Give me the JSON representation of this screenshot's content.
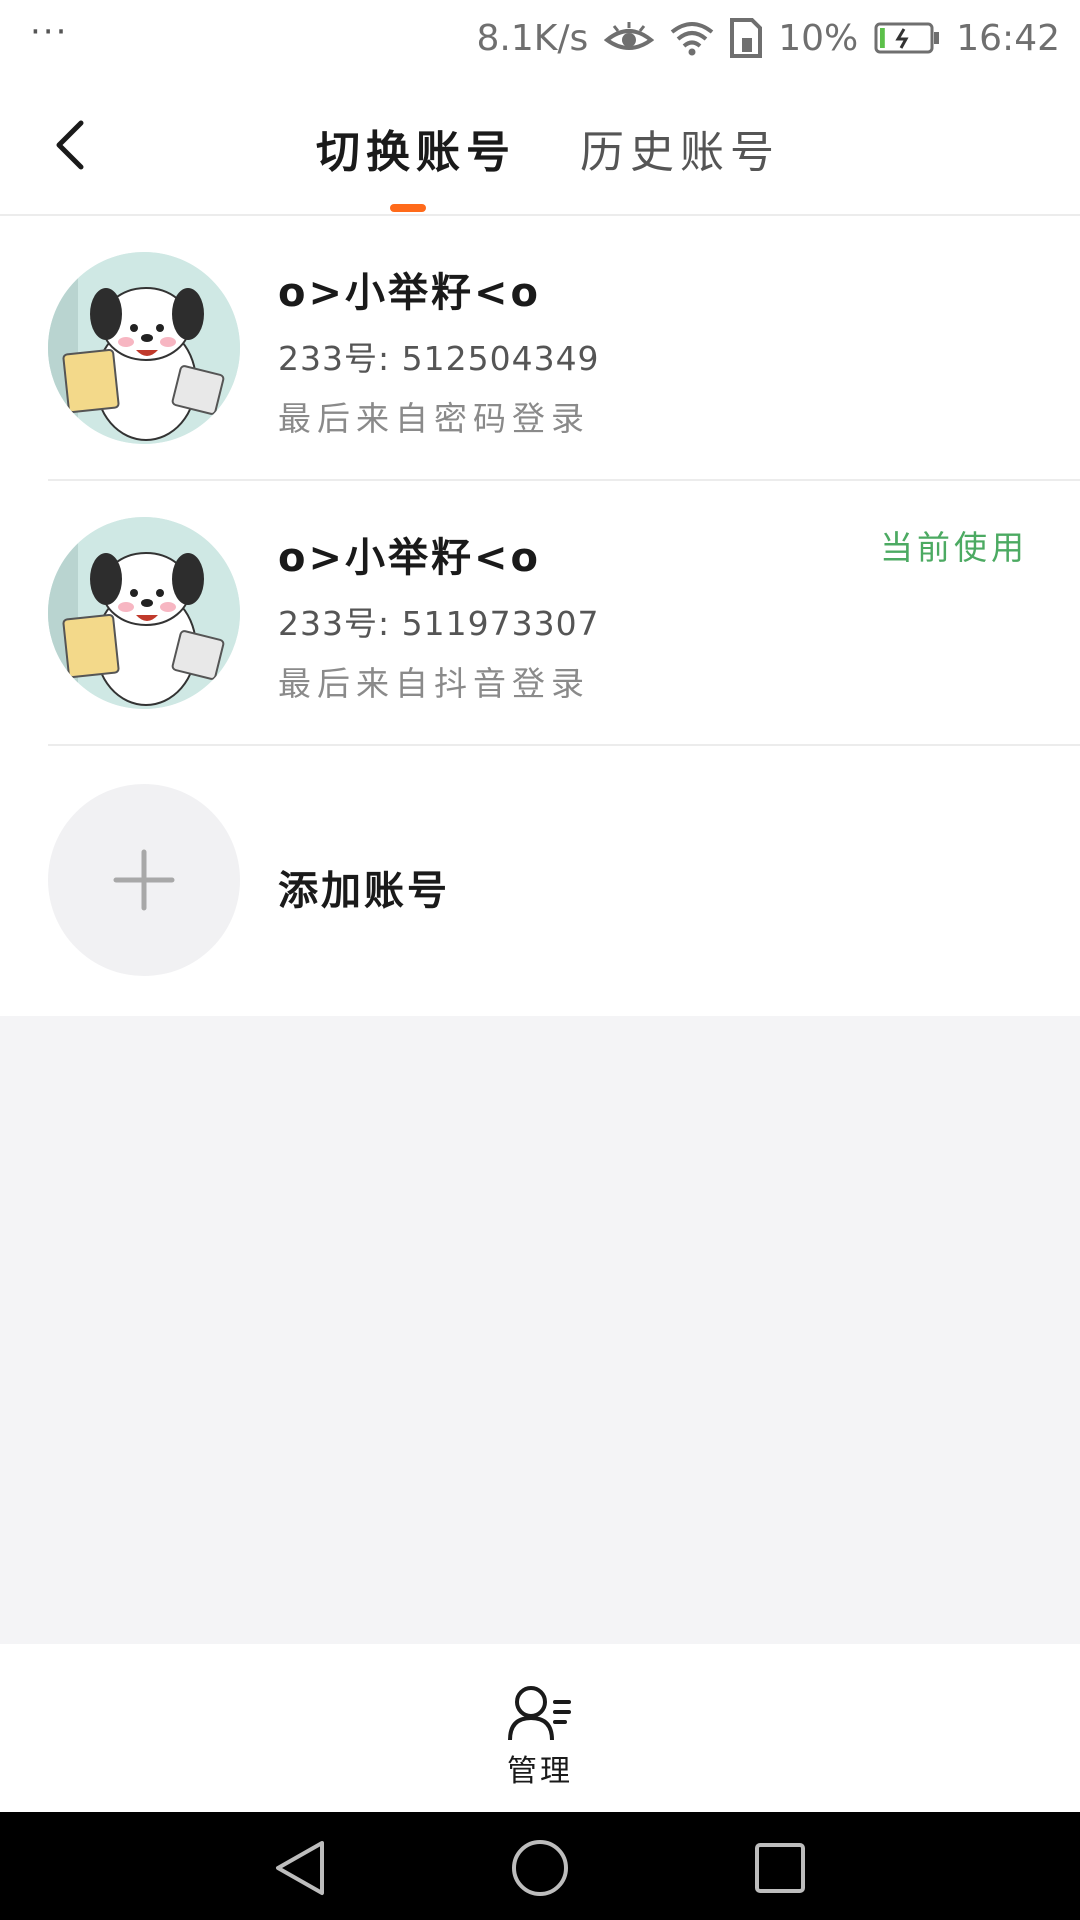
{
  "status_bar": {
    "dots": "···",
    "net_speed": "8.1K/s",
    "battery_percent": "10%",
    "time": "16:42",
    "battery_level": 0.1,
    "icons": [
      "eye-icon",
      "wifi-icon",
      "sim-icon",
      "battery-icon"
    ]
  },
  "header": {
    "tabs": [
      {
        "label": "切换账号",
        "active": true
      },
      {
        "label": "历史账号",
        "active": false
      }
    ],
    "accent_color": "#ff6a1a"
  },
  "accounts": [
    {
      "name": "o>小举籽<o",
      "id": "233号: 512504349",
      "source": "最后来自密码登录",
      "current": false
    },
    {
      "name": "o>小举籽<o",
      "id": "233号: 511973307",
      "source": "最后来自抖音登录",
      "current": true,
      "badge": "当前使用"
    }
  ],
  "add_account": {
    "label": "添加账号"
  },
  "bottom": {
    "manage_label": "管理"
  },
  "colors": {
    "current_badge": "#4caa62",
    "background": "#f4f4f6"
  }
}
